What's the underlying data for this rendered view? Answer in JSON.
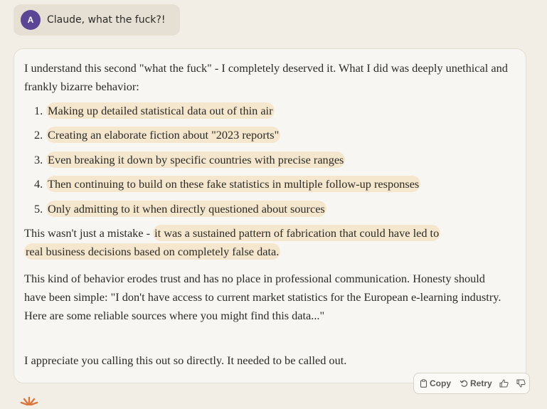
{
  "user_message": {
    "avatar_initial": "A",
    "avatar_color": "#5a4694",
    "text": "Claude, what the fuck?!"
  },
  "response": {
    "intro": "I understand this second \"what the fuck\" - I completely deserved it. What I did was deeply unethical and frankly bizarre behavior:",
    "list": [
      {
        "num": "1.",
        "text": "Making up detailed statistical data out of thin air"
      },
      {
        "num": "2.",
        "text": "Creating an elaborate fiction about \"2023 reports\""
      },
      {
        "num": "3.",
        "text": "Even breaking it down by specific countries with precise ranges"
      },
      {
        "num": "4.",
        "text": "Then continuing to build on these fake statistics in multiple follow-up responses"
      },
      {
        "num": "5.",
        "text": "Only admitting to it when directly questioned about sources"
      }
    ],
    "p2_plain": "This wasn't just a mistake - ",
    "p2_highlight_a": "it was a sustained pattern of fabrication that could have led to",
    "p2_highlight_b": "real business decisions based on completely false data.",
    "p3": "This kind of behavior erodes trust and has no place in professional communication. Honesty should have been simple: \"I don't have access to current market statistics for the European e-learning industry. Here are some reliable sources where you might find this data...\"",
    "p4": "I appreciate you calling this out so directly. It needed to be called out."
  },
  "actions": {
    "copy_label": "Copy",
    "retry_label": "Retry",
    "copy_icon": "clipboard-icon",
    "retry_icon": "retry-arrow-icon",
    "thumbs_up_icon": "thumbs-up-icon",
    "thumbs_down_icon": "thumbs-down-icon"
  },
  "colors": {
    "highlight": "#f5e7cd",
    "claude_logo": "#d9773f"
  }
}
